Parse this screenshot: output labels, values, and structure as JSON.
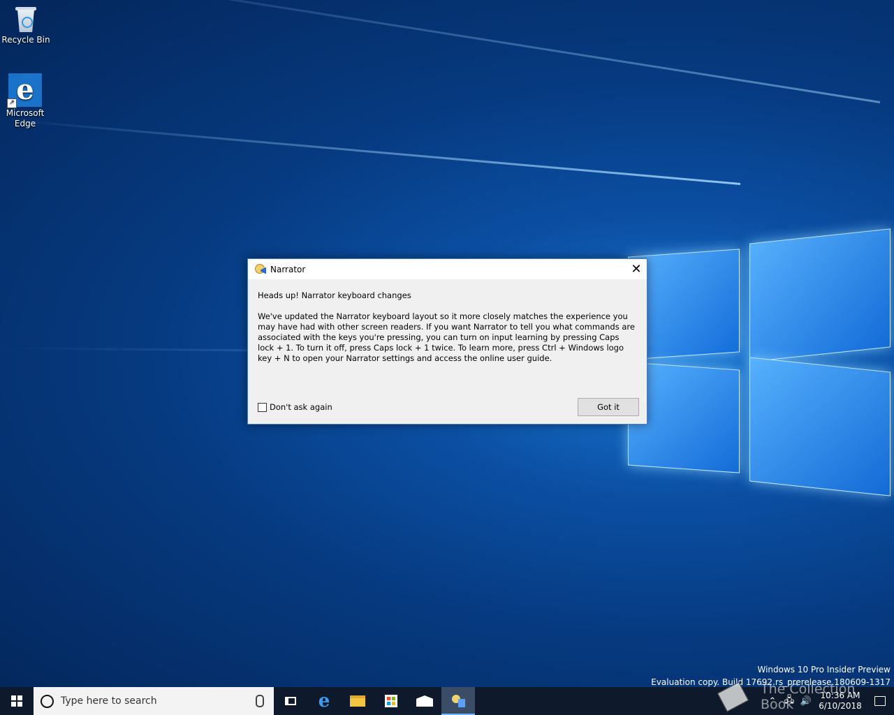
{
  "desktop": {
    "icons": [
      {
        "label": "Recycle Bin"
      },
      {
        "label": "Microsoft Edge"
      }
    ]
  },
  "dialog": {
    "title": "Narrator",
    "heading": "Heads up! Narrator keyboard changes",
    "message": "We've updated the Narrator keyboard layout so it more closely matches the experience you may have had with other screen readers. If you want Narrator to tell you what commands are associated with the keys you're pressing, you can turn on input learning by pressing Caps lock + 1. To turn it off, press Caps lock + 1 twice. To learn more, press Ctrl + Windows logo key + N to open your Narrator settings and access the online user guide.",
    "checkbox_label": "Don't ask again",
    "checkbox_checked": false,
    "button_label": "Got it"
  },
  "watermark": {
    "line1": "Windows 10 Pro Insider Preview",
    "line2": "Evaluation copy. Build 17692.rs_prerelease.180609-1317"
  },
  "taskbar": {
    "search_placeholder": "Type here to search",
    "apps": [
      "task-view",
      "microsoft-edge",
      "file-explorer",
      "microsoft-store",
      "mail",
      "narrator"
    ],
    "active_app": "narrator",
    "clock_time": "10:36 AM",
    "clock_date": "6/10/2018"
  },
  "overlay": {
    "text": "The Collection Book"
  },
  "colors": {
    "accent": "#0078d7",
    "taskbar": "#0e1a2b",
    "dialog_bg": "#f0f0f0"
  }
}
